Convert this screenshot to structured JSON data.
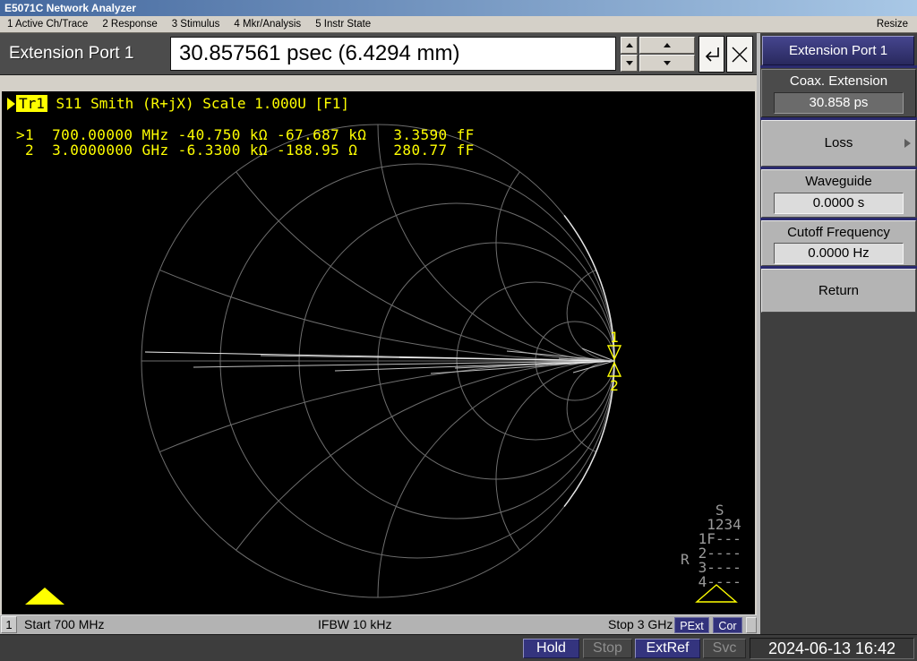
{
  "window": {
    "title": "E5071C Network Analyzer",
    "resize_label": "Resize"
  },
  "menu": {
    "items": [
      "1 Active Ch/Trace",
      "2 Response",
      "3 Stimulus",
      "4 Mkr/Analysis",
      "5 Instr State"
    ]
  },
  "entry": {
    "label": "Extension Port 1",
    "value": "30.857561 psec (6.4294 mm)"
  },
  "sidebar": {
    "title": "Extension Port 1",
    "softkeys": [
      {
        "label": "Coax. Extension",
        "value": "30.858 ps",
        "selected": true
      },
      {
        "label": "Loss",
        "has_submenu": true
      },
      {
        "label": "Waveguide",
        "value": "0.0000 s"
      },
      {
        "label": "Cutoff Frequency",
        "value": "0.0000 Hz"
      },
      {
        "label": "Return"
      }
    ]
  },
  "trace_header": {
    "trace_label": "Tr1",
    "text": " S11 Smith (R+jX) Scale 1.000U [F1]"
  },
  "chart_data": {
    "type": "smith",
    "title": "Tr1 S11 Smith (R+jX) Scale 1.000U [F1]",
    "format": "Smith (R+jX)",
    "scale": "1.000U",
    "stimulus": {
      "start": "700 MHz",
      "stop": "3 GHz",
      "ifbw": "10 kHz"
    },
    "markers": [
      {
        "n": "1",
        "active": true,
        "stimulus": "700.00000 MHz",
        "resistance": "-40.750 kΩ",
        "reactance": "-67.687 kΩ",
        "capacitance": "3.3590 fF",
        "gamma_position": "near +1 (open), above axis"
      },
      {
        "n": "2",
        "active": false,
        "stimulus": "3.0000000 GHz",
        "resistance": "-6.3300 kΩ",
        "reactance": "-188.95 Ω",
        "capacitance": "280.77 fF",
        "gamma_position": "near +1 (open), below axis"
      }
    ],
    "marker_display_lines": [
      ">1  700.00000 MHz -40.750 kΩ -67.687 kΩ   3.3590 fF",
      " 2  3.0000000 GHz -6.3300 kΩ -188.95 Ω    280.77 fF"
    ],
    "grid": {
      "r_circles": [
        0.2,
        0.5,
        1,
        2,
        5
      ],
      "x_arcs": [
        0.2,
        0.5,
        1,
        2,
        5
      ]
    },
    "trace": {
      "description": "S11 of open/capacitive DUT hugging |Γ|=1 at right edge with noisy radial fan",
      "edge_arc_deg": 38,
      "fan_segments": [
        [
          -524,
          -10
        ],
        [
          -470,
          7
        ],
        [
          -395,
          -6
        ],
        [
          -312,
          11
        ],
        [
          -240,
          -4
        ],
        [
          -205,
          14
        ],
        [
          -178,
          8
        ],
        [
          -120,
          -11
        ],
        [
          -88,
          4
        ],
        [
          -62,
          -3
        ],
        [
          -46,
          13
        ],
        [
          -36,
          -14
        ]
      ]
    },
    "legend_position": "none",
    "grid_on": true
  },
  "sparam_status": {
    "matrix": "   S\n  1234\n 1F---\n 2----\n 3----\n 4----",
    "receiver_label": "R"
  },
  "channel_bar": {
    "channel": "1",
    "start": "Start 700 MHz",
    "ifbw": "IFBW 10 kHz",
    "stop": "Stop 3 GHz",
    "badges": [
      {
        "label": "PExt"
      },
      {
        "label": "Cor"
      }
    ]
  },
  "status_bar": {
    "items": [
      {
        "label": "Hold",
        "active": true
      },
      {
        "label": "Stop",
        "active": false
      },
      {
        "label": "ExtRef",
        "active": true
      },
      {
        "label": "Svc",
        "active": false
      }
    ],
    "datetime": "2024-06-13 16:42"
  },
  "colors": {
    "titlebar_left": "#44689e",
    "titlebar_right": "#a9c8e6",
    "trace_yellow": "#ffff00",
    "grid_gray": "#6e6e6e",
    "softkey_navy": "#34347e",
    "panel_dark": "#4c4c4c",
    "chrome_gray": "#d4d0c8"
  }
}
